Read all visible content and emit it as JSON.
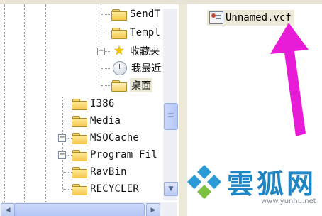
{
  "tree": {
    "items": [
      {
        "label": "SendT",
        "icon": "folder-icon"
      },
      {
        "label": "Templ",
        "icon": "folder-icon"
      },
      {
        "label": "收藏夹",
        "icon": "star-icon",
        "expandable": true
      },
      {
        "label": "我最近",
        "icon": "recent-docs-icon"
      },
      {
        "label": "桌面",
        "icon": "folder-icon",
        "selected": true
      },
      {
        "label": "I386",
        "icon": "folder-icon"
      },
      {
        "label": "Media",
        "icon": "folder-icon"
      },
      {
        "label": "MSOCache",
        "icon": "folder-icon",
        "expandable": true
      },
      {
        "label": "Program Fil",
        "icon": "folder-icon",
        "expandable": true
      },
      {
        "label": "RavBin",
        "icon": "folder-icon"
      },
      {
        "label": "RECYCLER",
        "icon": "folder-icon"
      }
    ]
  },
  "files": {
    "items": [
      {
        "label": "Unnamed.vcf",
        "icon": "vcard-file-icon",
        "selected": true
      }
    ]
  },
  "annotation": {
    "color": "#e81cd6",
    "points_to": "Unnamed.vcf"
  },
  "watermark": {
    "title": "雲狐网",
    "url": "www.yunhu.net"
  },
  "colors": {
    "selection": "#ece9d8",
    "folder": "#f2c94c",
    "scrollbar": "#b9c9f2"
  }
}
